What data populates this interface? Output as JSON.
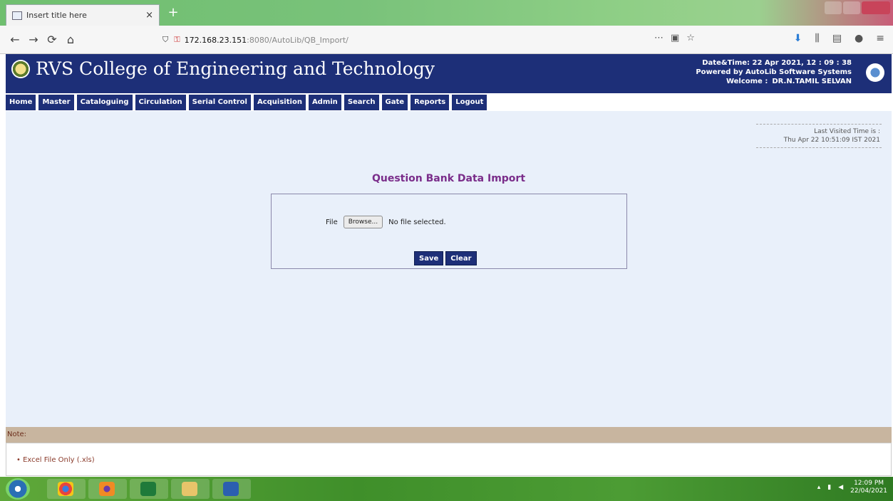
{
  "browser": {
    "tab_title": "Insert title here",
    "tab_close": "×",
    "new_tab": "+",
    "nav": {
      "back": "←",
      "forward": "→",
      "reload": "⟳",
      "home": "⌂"
    },
    "url_ip": "172.168.23.151",
    "url_path": ":8080/AutoLib/QB_Import/",
    "url_actions": [
      "⋯",
      "▣",
      "☆"
    ],
    "tools": [
      "⬇",
      "⫼",
      "▤",
      "●",
      "≡"
    ]
  },
  "header": {
    "title": "RVS College of Engineering and Technology",
    "datetime": "Date&Time:  22 Apr 2021, 12 : 09 : 38",
    "powered_by": "Powered by AutoLib Software Systems",
    "welcome_label": "Welcome   :",
    "welcome_name": "DR.N.TAMIL SELVAN"
  },
  "menu": [
    "Home",
    "Master",
    "Cataloguing",
    "Circulation",
    "Serial Control",
    "Acquisition",
    "Admin",
    "Search",
    "Gate",
    "Reports",
    "Logout"
  ],
  "last_visited": {
    "label": "Last Visited Time is :",
    "value": "Thu Apr 22 10:51:09 IST 2021"
  },
  "page_title": "Question Bank Data Import",
  "form": {
    "file_label": "File",
    "browse_label": "Browse...",
    "file_status": "No file selected.",
    "save_label": "Save",
    "clear_label": "Clear"
  },
  "note": {
    "heading": "Note:",
    "items": [
      "Excel File Only (.xls)"
    ]
  },
  "taskbar": {
    "time": "12:09 PM",
    "date": "22/04/2021"
  }
}
